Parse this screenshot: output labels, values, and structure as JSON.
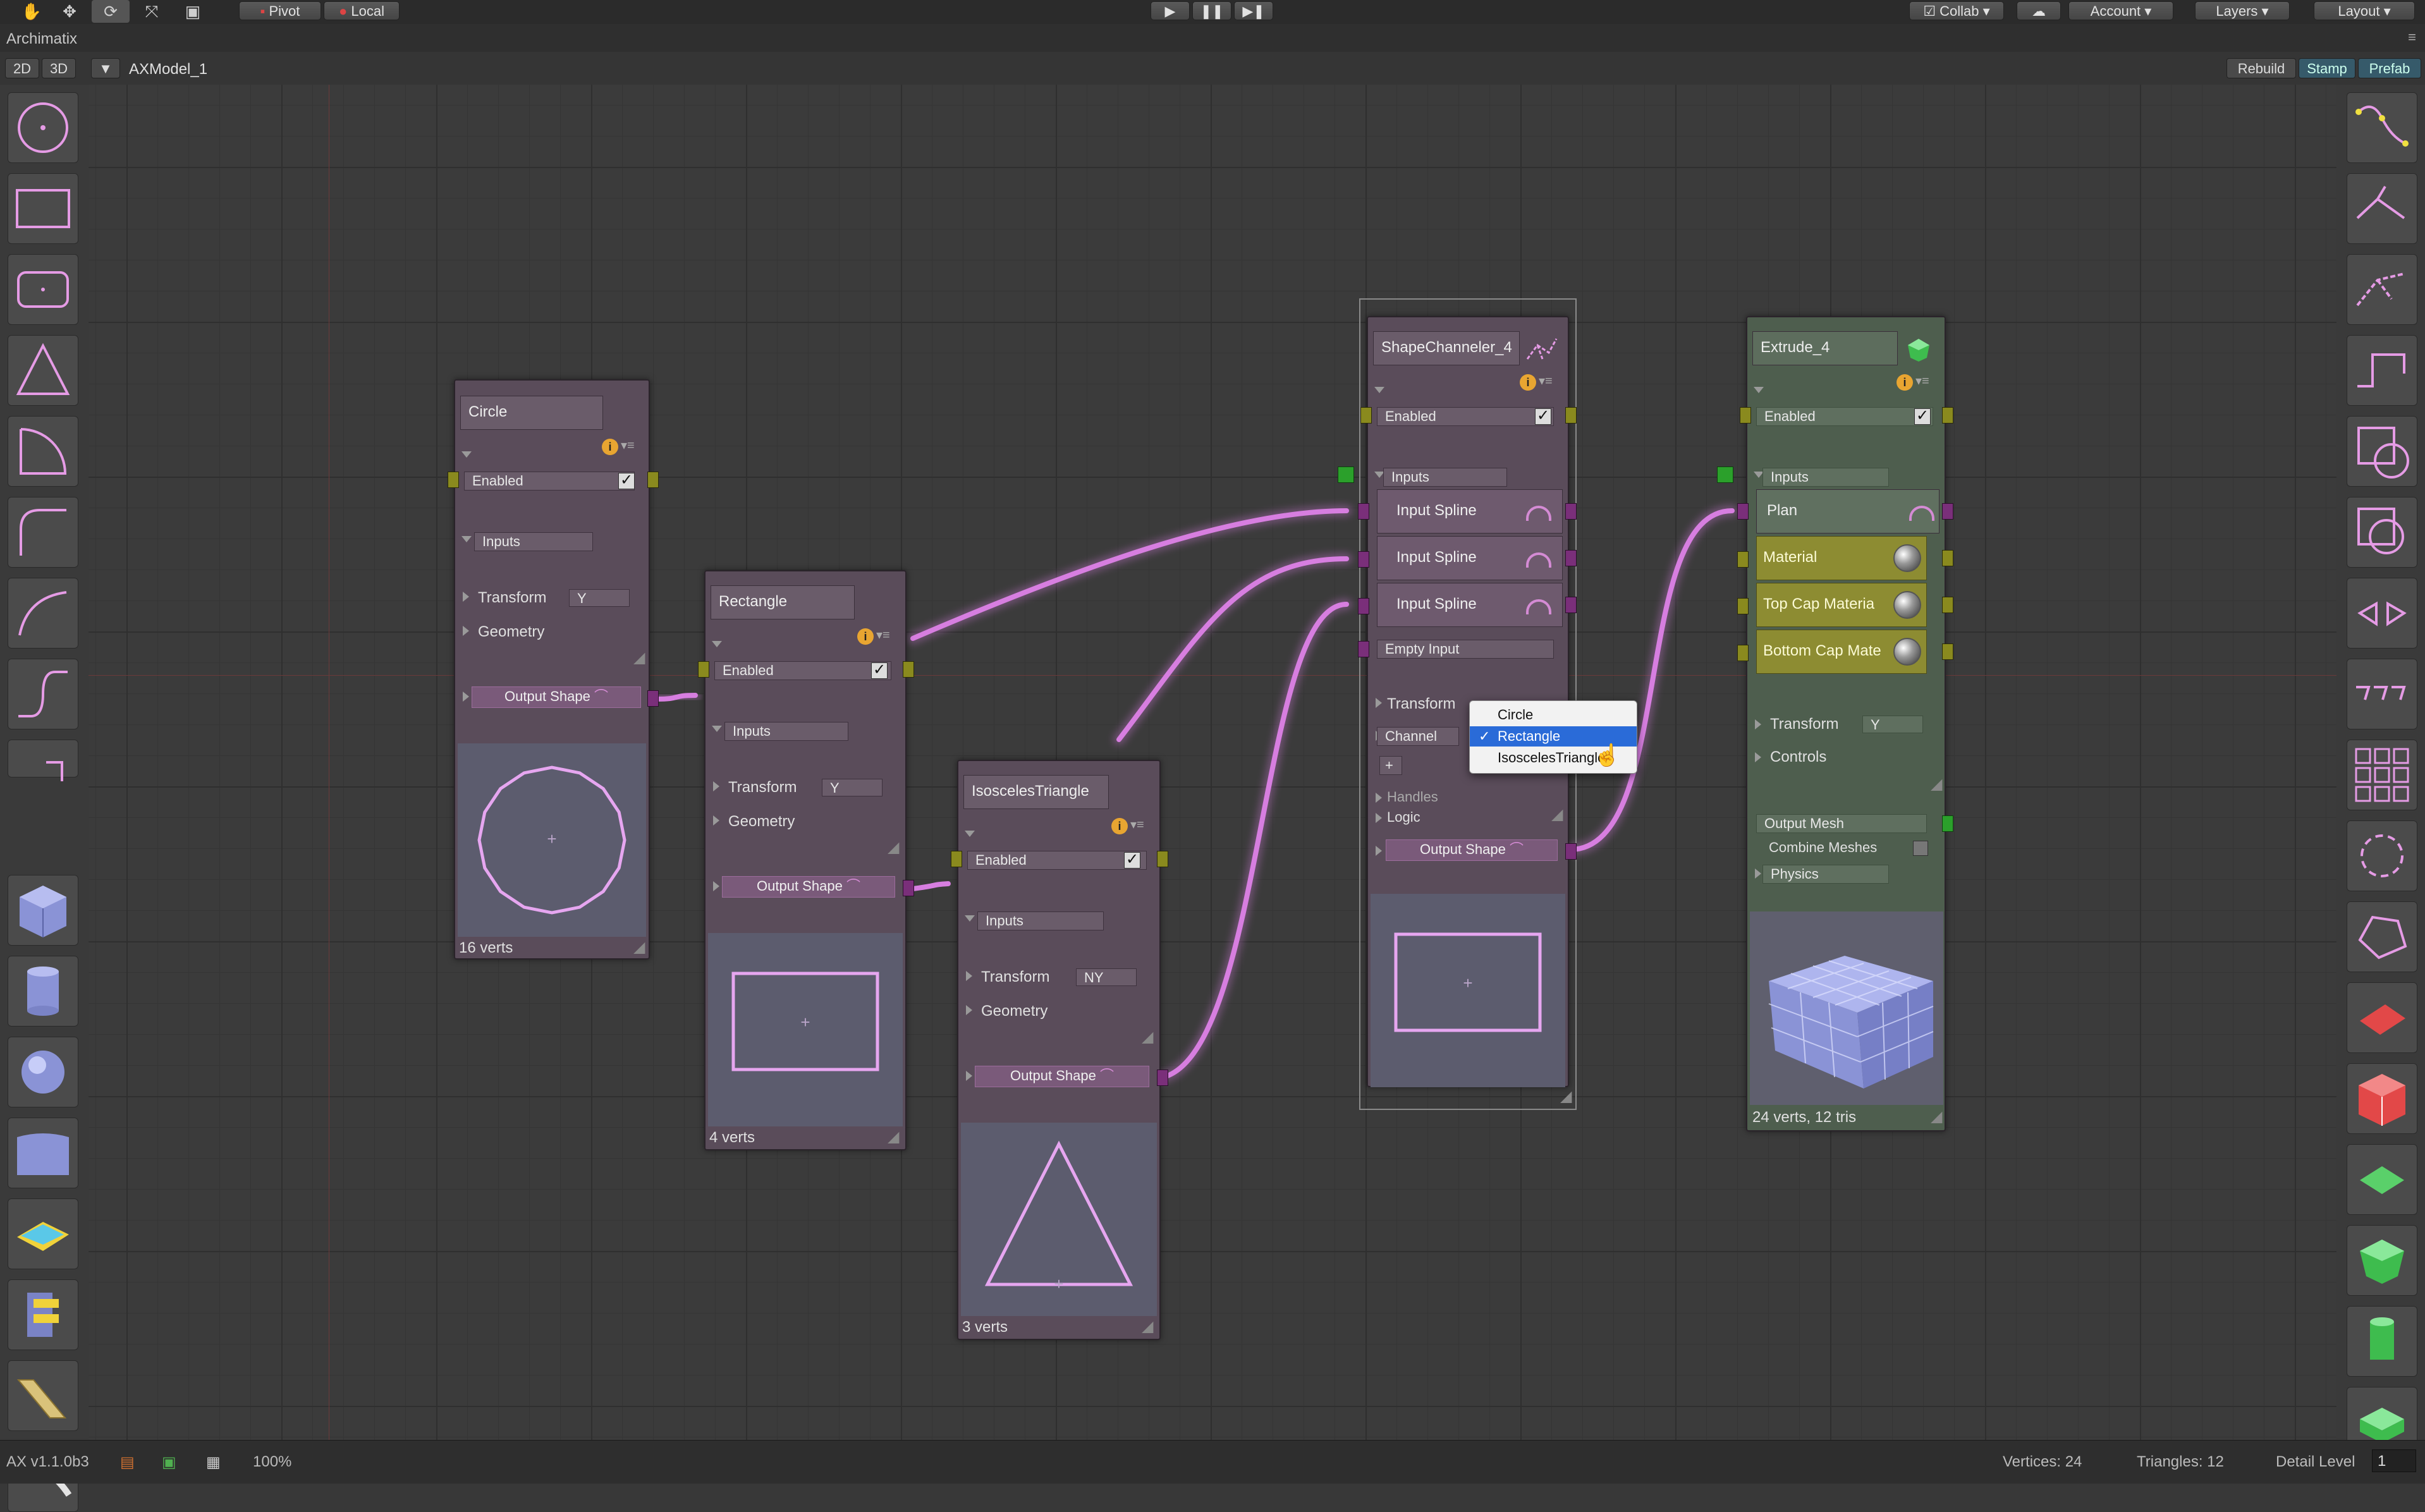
{
  "toolbar": {
    "pivot": "Pivot",
    "local": "Local",
    "collab": "Collab",
    "account": "Account",
    "layers": "Layers",
    "layout": "Layout"
  },
  "window": {
    "title": "Archimatix"
  },
  "subbar": {
    "mode_2d": "2D",
    "mode_3d": "3D",
    "model_name": "AXModel_1",
    "rebuild": "Rebuild",
    "stamp": "Stamp",
    "prefab": "Prefab"
  },
  "nodes": {
    "circle": {
      "title": "Circle",
      "enabled": "Enabled",
      "inputs": "Inputs",
      "transform": "Transform",
      "transform_axis": "Y",
      "geometry": "Geometry",
      "output": "Output Shape",
      "footer": "16 verts"
    },
    "rectangle": {
      "title": "Rectangle",
      "enabled": "Enabled",
      "inputs": "Inputs",
      "transform": "Transform",
      "transform_axis": "Y",
      "geometry": "Geometry",
      "output": "Output Shape",
      "footer": "4 verts"
    },
    "triangle": {
      "title": "IsoscelesTriangle",
      "enabled": "Enabled",
      "inputs": "Inputs",
      "transform": "Transform",
      "transform_axis": "NY",
      "geometry": "Geometry",
      "output": "Output Shape",
      "footer": "3 verts"
    },
    "channeler": {
      "title": "ShapeChanneler_4",
      "enabled": "Enabled",
      "inputs": "Inputs",
      "input_spline_1": "Input Spline",
      "input_spline_2": "Input Spline",
      "input_spline_3": "Input Spline",
      "empty_input": "Empty Input",
      "transform": "Transform",
      "channel": "Channel",
      "add": "+",
      "handles": "Handles",
      "logic": "Logic",
      "output": "Output Shape"
    },
    "extrude": {
      "title": "Extrude_4",
      "enabled": "Enabled",
      "inputs": "Inputs",
      "plan": "Plan",
      "material": "Material",
      "top_cap": "Top Cap Materia",
      "bottom_cap": "Bottom Cap Mate",
      "transform": "Transform",
      "transform_axis": "Y",
      "controls": "Controls",
      "output_mesh": "Output Mesh",
      "combine_meshes": "Combine Meshes",
      "physics": "Physics",
      "footer": "24 verts, 12 tris"
    }
  },
  "dropdown": {
    "options": [
      "Circle",
      "Rectangle",
      "IsoscelesTriangle"
    ],
    "selected": "Rectangle",
    "check": "✓"
  },
  "status": {
    "version": "AX v1.1.0b3",
    "zoom": "100%",
    "vertices": "Vertices: 24",
    "triangles": "Triangles: 12",
    "detail_label": "Detail Level",
    "detail_value": "1"
  },
  "colors": {
    "wire": "#d77ee0",
    "node_purple": "#5a4c5a",
    "node_green": "#4e5e4e",
    "material_slot": "#8d8c32",
    "selected": "#2a6bd8"
  },
  "icons": {
    "left_palette": [
      "circle-shape-icon",
      "rectangle-shape-icon",
      "rounded-rectangle-icon",
      "triangle-icon",
      "arc-icon",
      "fillet-icon",
      "curve-icon",
      "s-curve-icon",
      "corner-icon",
      "box-mesh-icon",
      "cylinder-mesh-icon",
      "sphere-mesh-icon",
      "curved-panel-icon",
      "soap-icon",
      "stair-building-icon",
      "stairs-icon",
      "ramp-icon"
    ],
    "right_palette": [
      "spline-icon",
      "shape-merger-icon",
      "shape-distributor-icon",
      "offset-icon",
      "shape-offset-icon",
      "combine-icon",
      "mirror-icon",
      "grid-repeater-icon",
      "grid-icon",
      "radial-repeater-icon",
      "freeform-icon",
      "plane-icon",
      "cube-icon",
      "lathe-icon",
      "extrude-icon",
      "pipe-icon",
      "stack-icon"
    ]
  }
}
